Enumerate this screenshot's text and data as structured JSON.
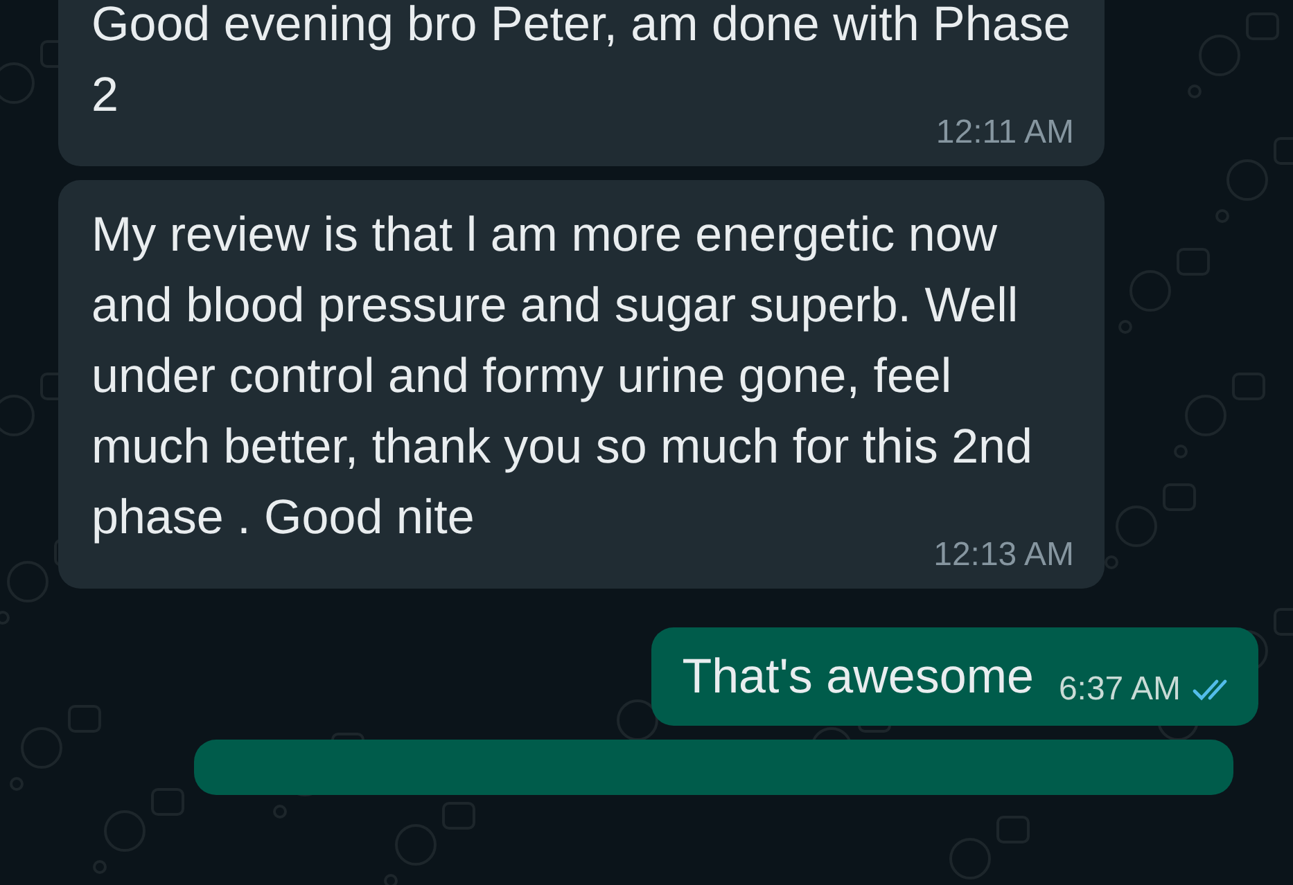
{
  "messages": [
    {
      "kind": "incoming",
      "text": "Good evening bro Peter, am done with Phase 2",
      "time": "12:11 AM"
    },
    {
      "kind": "incoming",
      "text": "My review is that l am more energetic now and blood pressure and sugar superb. Well under control and formy urine gone, feel much better, thank you so much for this 2nd phase . Good nite",
      "time": "12:13 AM"
    },
    {
      "kind": "outgoing",
      "text": "That's awesome",
      "time": "6:37 AM",
      "read": true
    },
    {
      "kind": "cut-off"
    }
  ]
}
